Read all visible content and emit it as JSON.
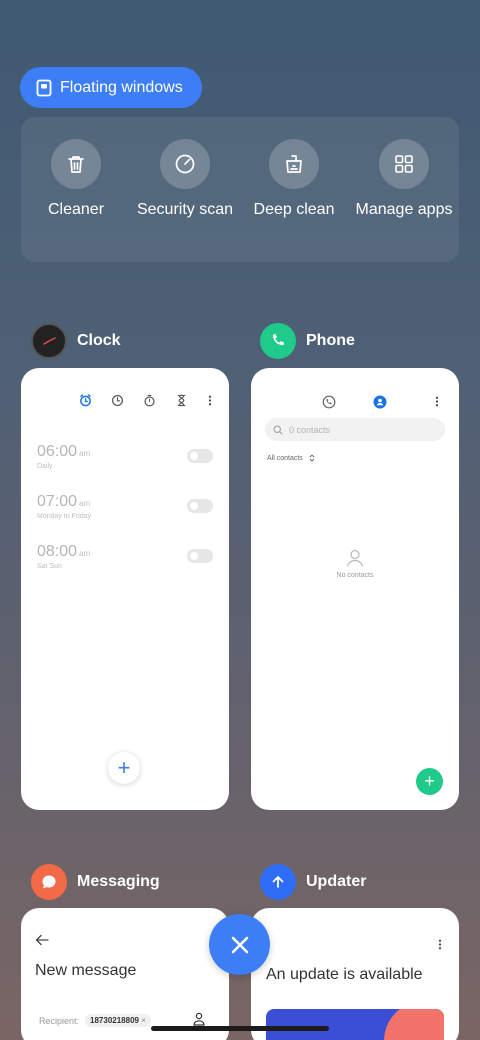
{
  "floating_windows": {
    "label": "Floating windows"
  },
  "tools": [
    {
      "label": "Cleaner",
      "icon": "trash-icon"
    },
    {
      "label": "Security scan",
      "icon": "security-scan-icon"
    },
    {
      "label": "Deep clean",
      "icon": "deep-clean-icon"
    },
    {
      "label": "Manage apps",
      "icon": "grid-icon"
    }
  ],
  "apps": {
    "clock": {
      "name": "Clock",
      "alarms": [
        {
          "time": "06:00",
          "ampm": "am",
          "repeat": "Daily"
        },
        {
          "time": "07:00",
          "ampm": "am",
          "repeat": "Monday to Friday"
        },
        {
          "time": "08:00",
          "ampm": "am",
          "repeat": "Sat Sun"
        }
      ],
      "fab": "+"
    },
    "phone": {
      "name": "Phone",
      "search_placeholder": "0 contacts",
      "filter": "All contacts",
      "empty_text": "No contacts",
      "fab": "+"
    },
    "messaging": {
      "name": "Messaging",
      "title": "New message",
      "recipient_label": "Recipient:",
      "recipient_value": "18730218809",
      "chip_remove": "×"
    },
    "updater": {
      "name": "Updater",
      "title": "An update is available"
    }
  },
  "colors": {
    "accent": "#3d7ef7",
    "phone_green": "#1fca8a",
    "messaging_orange": "#f26a46",
    "updater_blue": "#2f6df6"
  }
}
